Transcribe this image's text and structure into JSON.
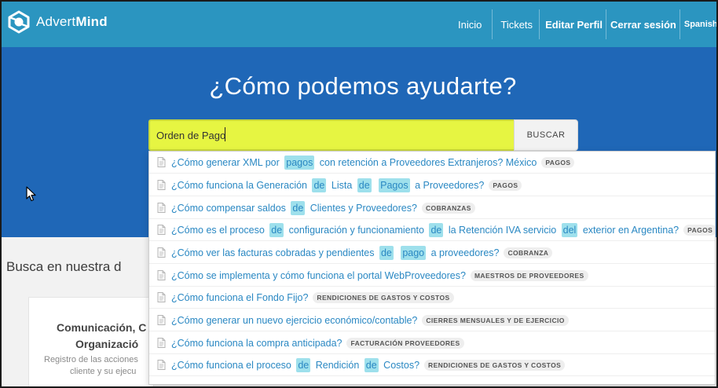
{
  "header": {
    "logo_plain": "Advert",
    "logo_bold": "Mind",
    "nav": [
      "Inicio",
      "Tickets",
      "Editar Perfil",
      "Cerrar sesión",
      "Spanish"
    ]
  },
  "hero": {
    "title": "¿Cómo podemos ayudarte?",
    "search_value": "Orden de Pago",
    "search_button": "BUSCAR"
  },
  "page": {
    "section_title": "Busca en nuestra d",
    "card_title_line1": "Comunicación, C",
    "card_title_line2": "Organizació",
    "card_desc_line1": "Registro de las acciones",
    "card_desc_line2": "cliente y su ejecu"
  },
  "suggestions": [
    {
      "parts": [
        [
          "¿Cómo generar XML por ",
          false
        ],
        [
          "pagos",
          true
        ],
        [
          " con retención a Proveedores Extranjeros? México",
          false
        ]
      ],
      "tag": "PAGOS"
    },
    {
      "parts": [
        [
          "¿Cómo funciona la Generación ",
          false
        ],
        [
          "de",
          true
        ],
        [
          " Lista ",
          false
        ],
        [
          "de",
          true
        ],
        [
          " ",
          false
        ],
        [
          "Pagos",
          true
        ],
        [
          " a Proveedores?",
          false
        ]
      ],
      "tag": "PAGOS"
    },
    {
      "parts": [
        [
          "¿Cómo compensar saldos ",
          false
        ],
        [
          "de",
          true
        ],
        [
          " Clientes y Proveedores?",
          false
        ]
      ],
      "tag": "COBRANZAS"
    },
    {
      "parts": [
        [
          "¿Cómo es el proceso ",
          false
        ],
        [
          "de",
          true
        ],
        [
          " configuración y funcionamiento ",
          false
        ],
        [
          "de",
          true
        ],
        [
          " la Retención IVA servicio ",
          false
        ],
        [
          "del",
          true
        ],
        [
          " exterior en Argentina?",
          false
        ]
      ],
      "tag": "PAGOS"
    },
    {
      "parts": [
        [
          "¿Cómo ver las facturas cobradas y pendientes ",
          false
        ],
        [
          "de",
          true
        ],
        [
          " ",
          false
        ],
        [
          "pago",
          true
        ],
        [
          " a proveedores?",
          false
        ]
      ],
      "tag": "COBRANZA"
    },
    {
      "parts": [
        [
          "¿Cómo se implementa y cómo funciona el portal WebProveedores?",
          false
        ]
      ],
      "tag": "MAESTROS DE PROVEEDORES"
    },
    {
      "parts": [
        [
          "¿Cómo funciona el Fondo Fijo?",
          false
        ]
      ],
      "tag": "RENDICIONES DE GASTOS Y COSTOS"
    },
    {
      "parts": [
        [
          "¿Cómo generar un nuevo ejercicio económico/contable?",
          false
        ]
      ],
      "tag": "CIERRES MENSUALES Y DE EJERCICIO"
    },
    {
      "parts": [
        [
          "¿Cómo funciona la compra anticipada?",
          false
        ]
      ],
      "tag": "FACTURACIÓN PROVEEDORES"
    },
    {
      "parts": [
        [
          "¿Cómo funciona el proceso ",
          false
        ],
        [
          "de",
          true
        ],
        [
          " Rendición ",
          false
        ],
        [
          "de",
          true
        ],
        [
          " Costos?",
          false
        ]
      ],
      "tag": "RENDICIONES DE GASTOS Y COSTOS"
    }
  ],
  "colors": {
    "header": "#2b95c0",
    "hero": "#1f67b7",
    "search_highlight": "#e6f542",
    "match_highlight": "#9ee0ec",
    "link": "#2a88c3"
  },
  "icons": [
    "advertmind-logo-icon",
    "document-icon",
    "mouse-pointer-icon"
  ]
}
